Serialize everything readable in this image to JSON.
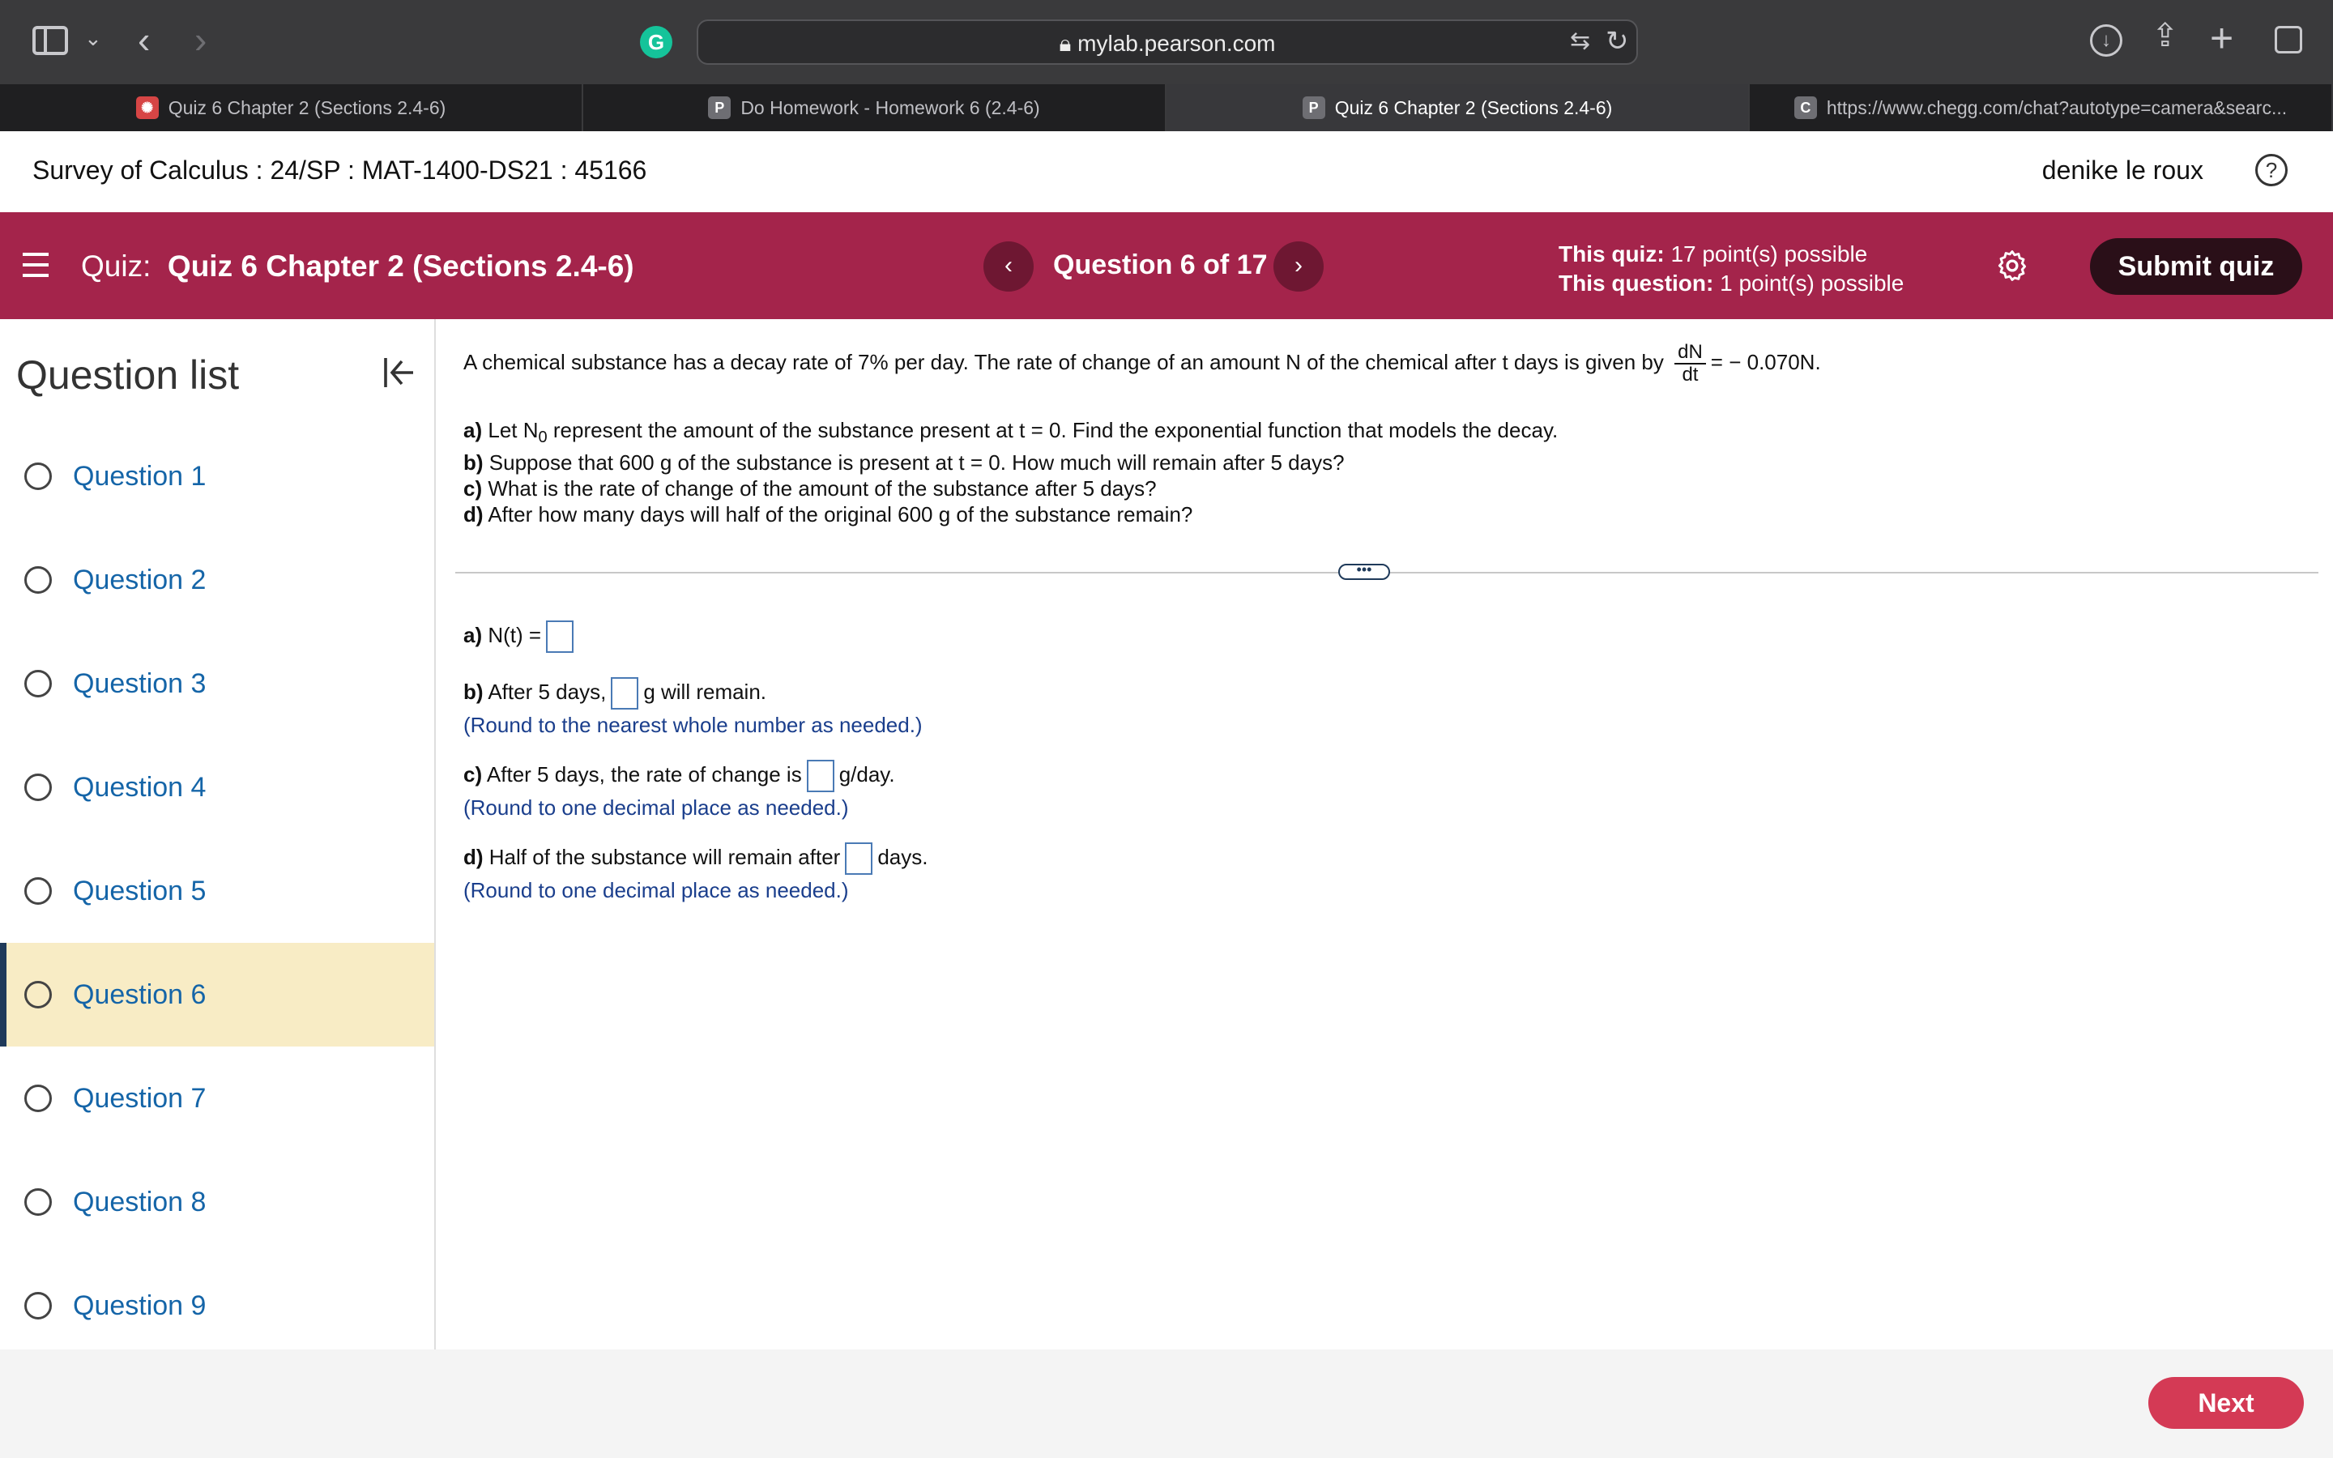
{
  "browser": {
    "url": "mylab.pearson.com",
    "tabs": [
      {
        "label": "Quiz 6 Chapter 2 (Sections 2.4-6)",
        "badge": ""
      },
      {
        "label": "Do Homework - Homework 6 (2.4-6)",
        "badge": "P"
      },
      {
        "label": "Quiz 6 Chapter 2 (Sections 2.4-6)",
        "badge": "P"
      },
      {
        "label": "https://www.chegg.com/chat?autotype=camera&searc...",
        "badge": "C"
      }
    ],
    "active_tab": 2
  },
  "course": {
    "title": "Survey of Calculus : 24/SP : MAT-1400-DS21 : 45166",
    "user": "denike le roux",
    "help": "?"
  },
  "quiz_bar": {
    "quiz_prefix": "Quiz:",
    "quiz_name": "Quiz 6 Chapter 2 (Sections 2.4-6)",
    "question_counter": "Question 6 of 17",
    "prev": "‹",
    "next": "›",
    "quiz_points_label": "This quiz:",
    "quiz_points": "17 point(s) possible",
    "question_points_label": "This question:",
    "question_points": "1 point(s) possible",
    "submit_label": "Submit quiz"
  },
  "question_list": {
    "title": "Question list",
    "active_index": 5,
    "items": [
      "Question 1",
      "Question 2",
      "Question 3",
      "Question 4",
      "Question 5",
      "Question 6",
      "Question 7",
      "Question 8",
      "Question 9"
    ]
  },
  "question": {
    "intro": "A chemical substance has a decay rate of 7% per day. The rate of change of an amount N of the chemical after t days is given by",
    "frac_num": "dN",
    "frac_den": "dt",
    "intro_end": "= − 0.070N.",
    "part_a_label": "a)",
    "part_a_pre": "Let N",
    "part_a_sub": "0",
    "part_a_post": "represent the amount of the substance present at t = 0. Find the exponential function that models the decay.",
    "part_b_label": "b)",
    "part_b": "Suppose that 600 g of the substance is present at t = 0. How much will remain after 5 days?",
    "part_c_label": "c)",
    "part_c": "What is the rate of change of the amount of the substance after 5 days?",
    "part_d_label": "d)",
    "part_d": "After how many days will half of the original 600 g of the substance remain?",
    "divider_handle": "•••"
  },
  "answers": {
    "a_label": "a)",
    "a_text": "N(t) =",
    "b_label": "b)",
    "b_pre": "After 5 days,",
    "b_post": "g will remain.",
    "b_hint": "(Round to the nearest whole number as needed.)",
    "c_label": "c)",
    "c_pre": "After 5 days, the rate of change is",
    "c_post": "g/day.",
    "c_hint": "(Round to one decimal place as needed.)",
    "d_label": "d)",
    "d_pre": "Half of the substance will remain after",
    "d_post": "days.",
    "d_hint": "(Round to one decimal place as needed.)"
  },
  "footer": {
    "next_label": "Next"
  }
}
